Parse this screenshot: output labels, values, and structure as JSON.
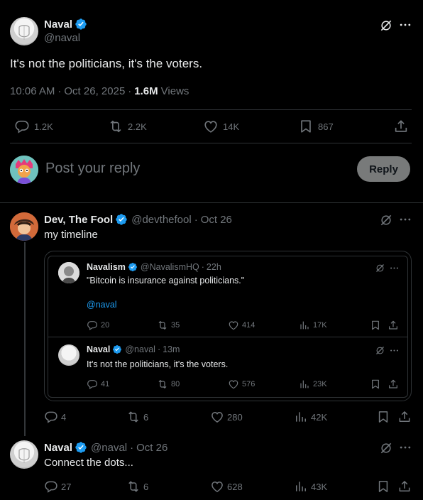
{
  "main_tweet": {
    "author_name": "Naval",
    "author_handle": "@naval",
    "text": "It's not the politicians, it's the voters.",
    "time": "10:06 AM",
    "date": "Oct 26, 2025",
    "views_count": "1.6M",
    "views_label": "Views",
    "replies": "1.2K",
    "reposts": "2.2K",
    "likes": "14K",
    "bookmarks": "867"
  },
  "reply_box": {
    "placeholder": "Post your reply",
    "button_label": "Reply"
  },
  "reply1": {
    "author_name": "Dev, The Fool",
    "author_handle": "@devthefool",
    "date": "Oct 26",
    "text": "my timeline",
    "replies": "4",
    "reposts": "6",
    "likes": "280",
    "views": "42K",
    "quote1": {
      "author_name": "Navalism",
      "author_handle": "@NavalismHQ",
      "time": "22h",
      "text": "\"Bitcoin is insurance against politicians.\"",
      "mention": "@naval",
      "replies": "20",
      "reposts": "35",
      "likes": "414",
      "views": "17K"
    },
    "quote2": {
      "author_name": "Naval",
      "author_handle": "@naval",
      "time": "13m",
      "text": "It's not the politicians, it's the voters.",
      "replies": "41",
      "reposts": "80",
      "likes": "576",
      "views": "23K"
    }
  },
  "reply2": {
    "author_name": "Naval",
    "author_handle": "@naval",
    "date": "Oct 26",
    "text": "Connect the dots...",
    "replies": "27",
    "reposts": "6",
    "likes": "628",
    "views": "43K"
  },
  "colors": {
    "accent": "#1d9bf0",
    "text": "#e7e9ea",
    "muted": "#71767b",
    "border": "#2f3336"
  }
}
